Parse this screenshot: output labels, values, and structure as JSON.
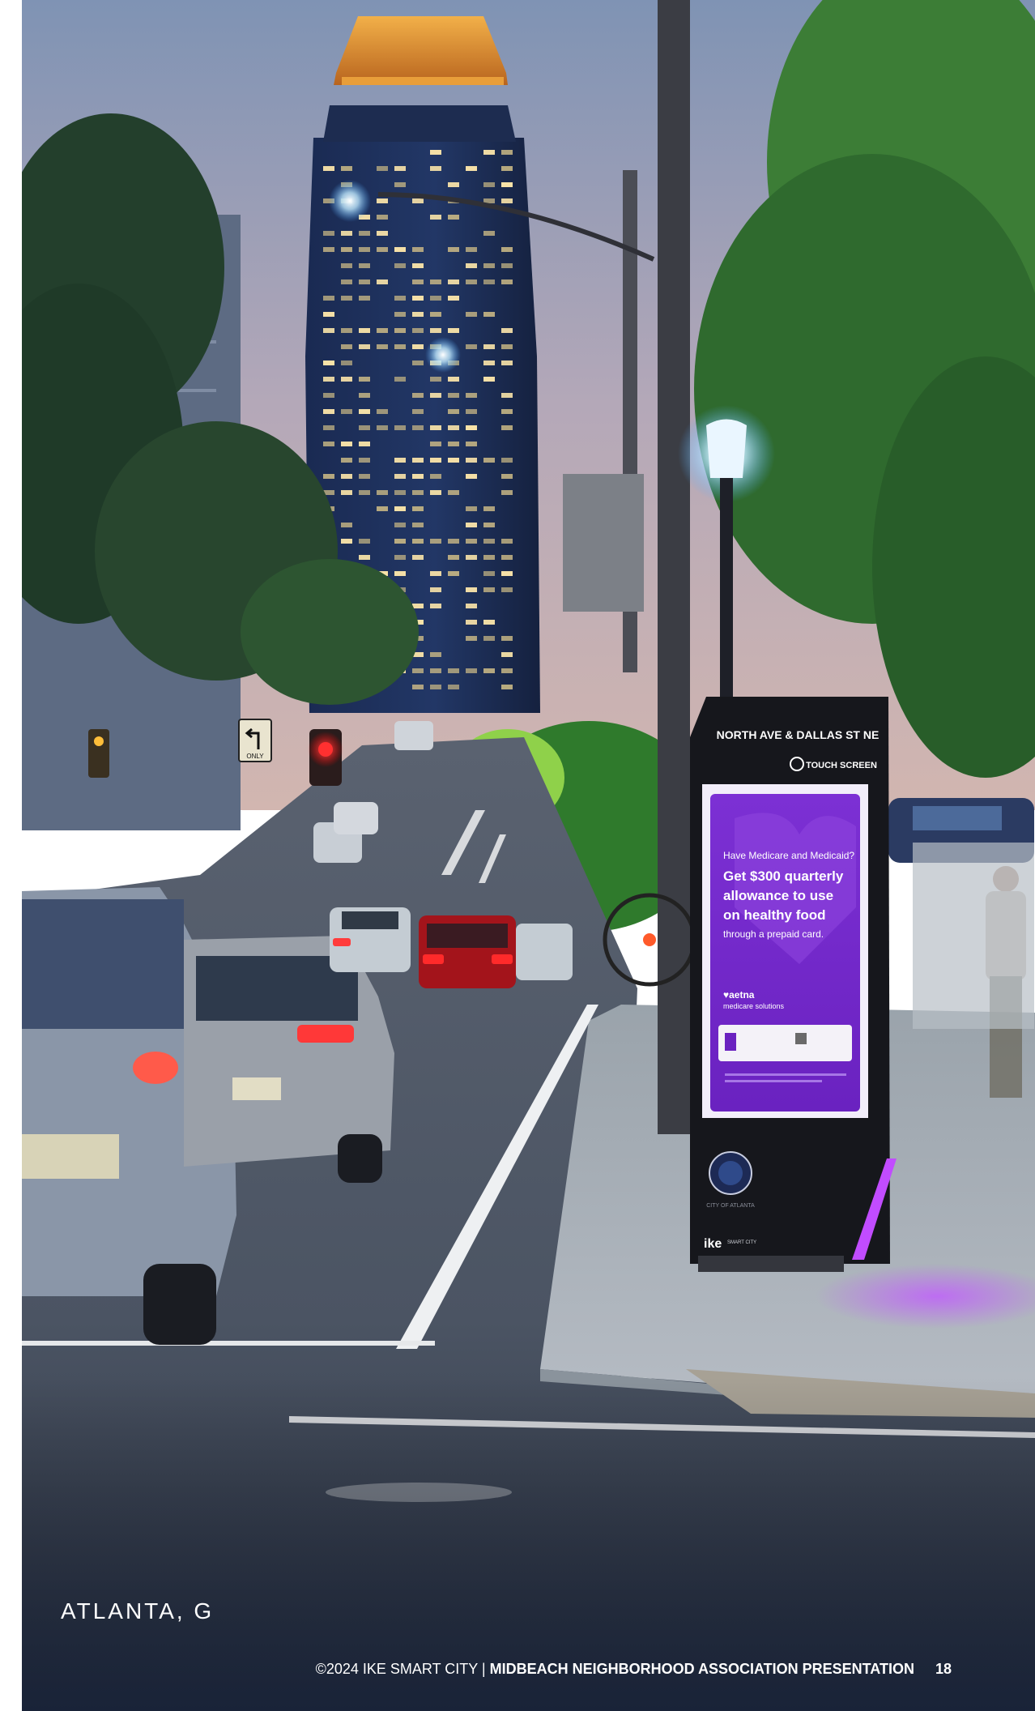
{
  "photo": {
    "description_icon": "street-photo",
    "kiosk": {
      "street_sign": "NORTH AVE & DALLAS ST NE",
      "touch_label": "TOUCH SCREEN",
      "ad": {
        "question": "Have Medicare and Medicaid?",
        "headline_1": "Get $300 quarterly",
        "headline_2": "allowance to use",
        "headline_3": "on healthy food",
        "subline": "through a prepaid card.",
        "brand": "♥aetna",
        "brand_sub": "medicare solutions"
      },
      "seal_text": "CITY OF ATLANTA",
      "maker": "ike",
      "maker_sub": "SMART CITY"
    },
    "road_sign": "ONLY"
  },
  "caption": {
    "city": "ATLANTA, G"
  },
  "footer": {
    "copyright": "©2024 IKE SMART CITY | ",
    "title": "MIDBEACH  NEIGHBORHOOD ASSOCIATION PRESENTATION",
    "page_number": "18"
  },
  "colors": {
    "sky_top": "#7f93b4",
    "sky_bottom": "#c7b4b5",
    "tower": "#1c2d54",
    "tower_crown": "#d9912e",
    "trees": "#275a2a",
    "road": "#4b5463",
    "kiosk_screen": "#7a2fd0",
    "kiosk_body": "#16171c"
  }
}
